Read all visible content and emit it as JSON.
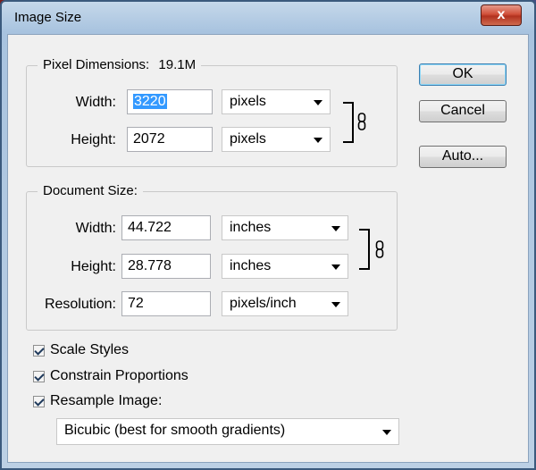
{
  "window": {
    "title": "Image Size",
    "close_label": "x"
  },
  "pixel_dimensions": {
    "legend": "Pixel Dimensions:",
    "size_value": "19.1M",
    "width_label": "Width:",
    "width_value": "3220",
    "width_unit": "pixels",
    "height_label": "Height:",
    "height_value": "2072",
    "height_unit": "pixels"
  },
  "document_size": {
    "legend": "Document Size:",
    "width_label": "Width:",
    "width_value": "44.722",
    "width_unit": "inches",
    "height_label": "Height:",
    "height_value": "28.778",
    "height_unit": "inches",
    "resolution_label": "Resolution:",
    "resolution_value": "72",
    "resolution_unit": "pixels/inch"
  },
  "buttons": {
    "ok": "OK",
    "cancel": "Cancel",
    "auto": "Auto..."
  },
  "options": {
    "scale_styles": "Scale Styles",
    "constrain_proportions": "Constrain Proportions",
    "resample_image": "Resample Image:",
    "resample_method": "Bicubic (best for smooth gradients)"
  }
}
